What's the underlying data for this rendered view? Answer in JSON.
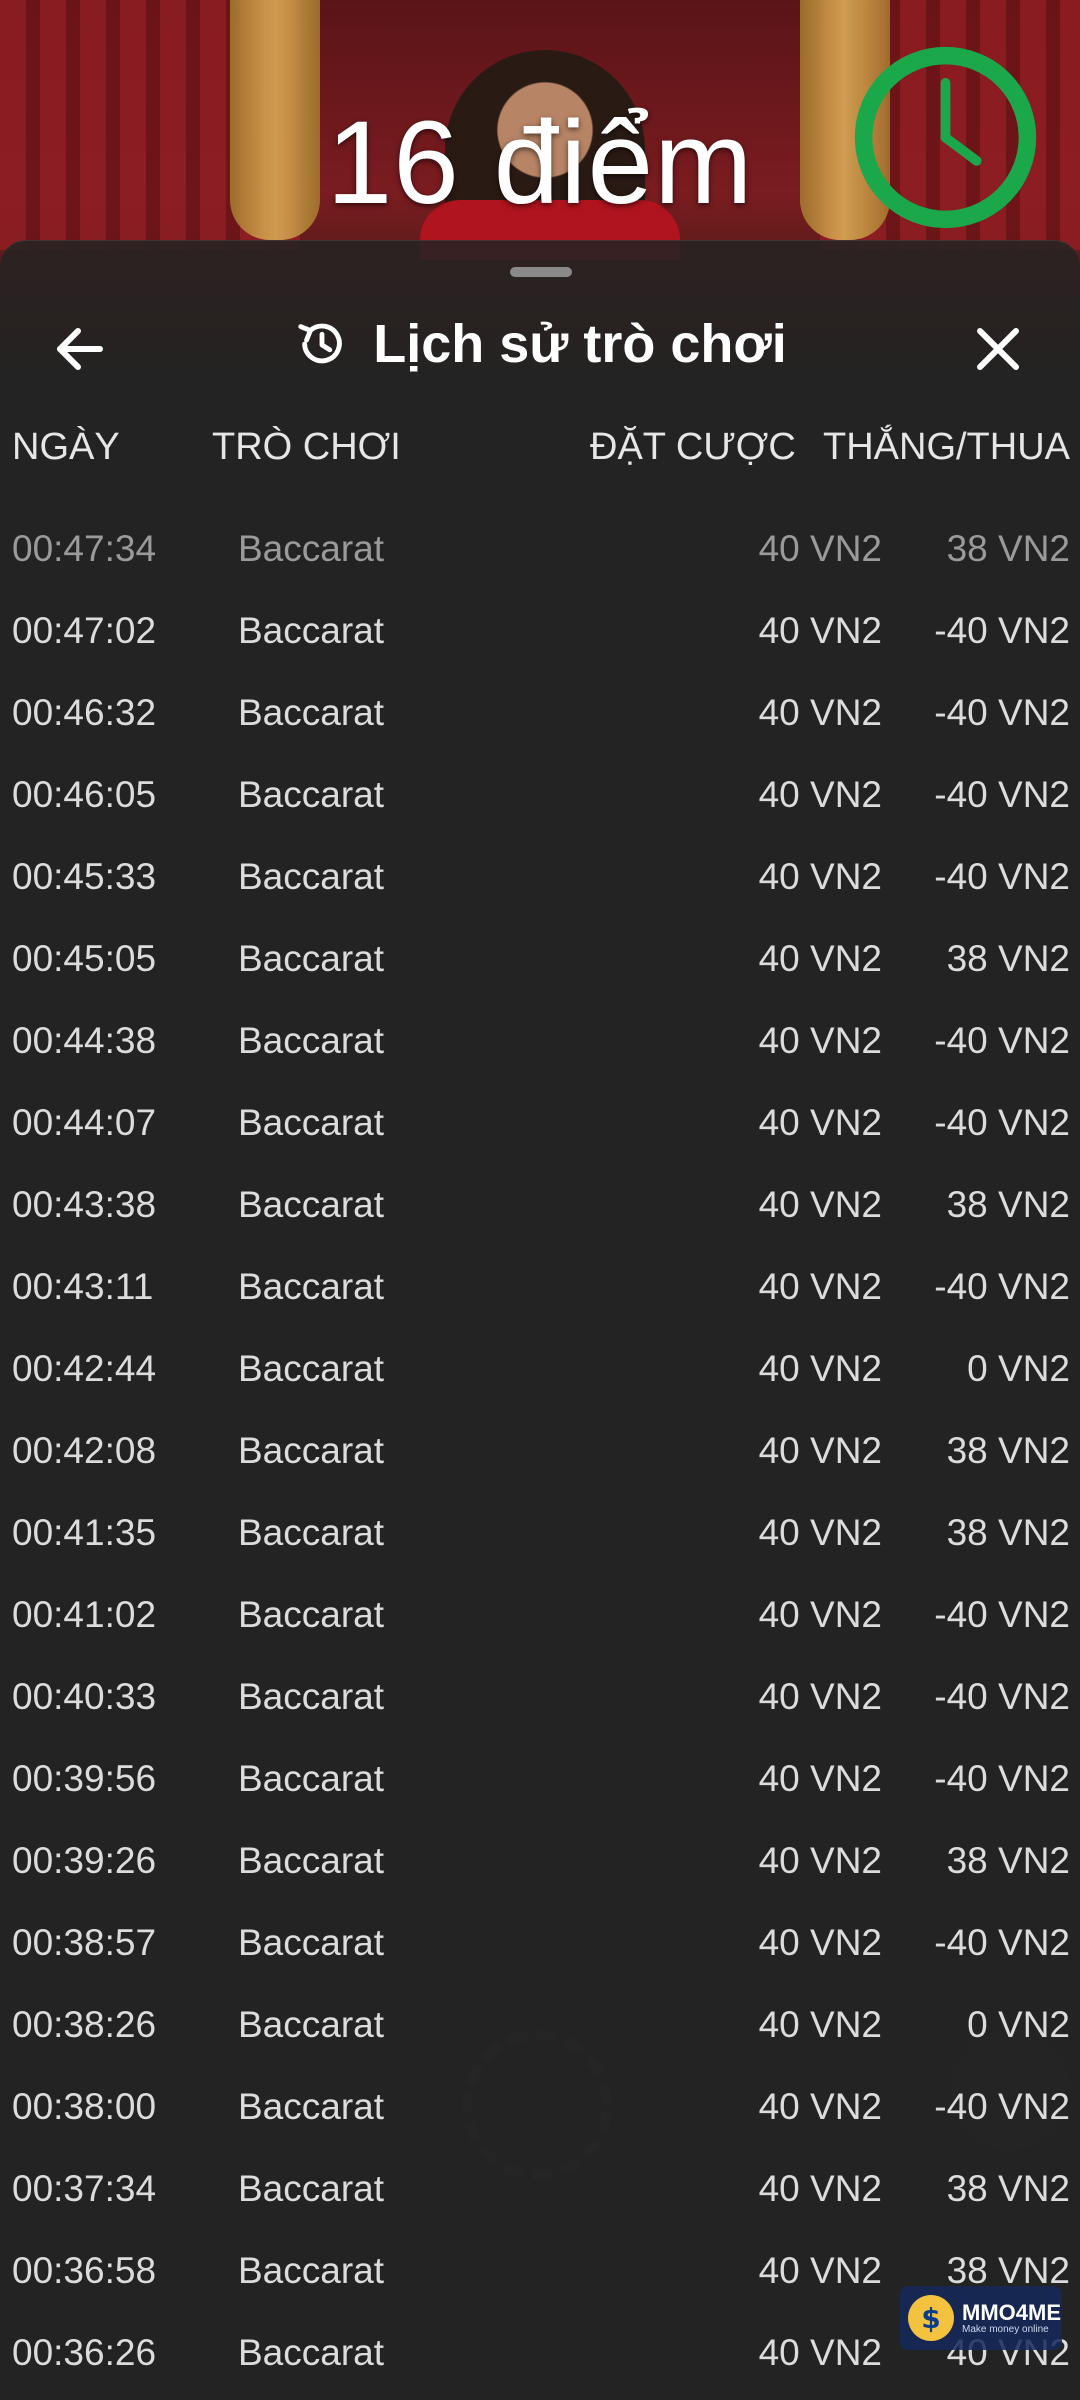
{
  "background": {
    "score_text": "16 điểm"
  },
  "sheet": {
    "title": "Lịch sử trò chơi",
    "columns": {
      "date": "NGÀY",
      "game": "TRÒ CHƠI",
      "bet": "ĐẶT CƯỢC",
      "result": "THẮNG/THUA"
    },
    "rows": [
      {
        "time": "00:47:34",
        "game": "Baccarat",
        "bet": "40 VN2",
        "result": "38 VN2"
      },
      {
        "time": "00:47:02",
        "game": "Baccarat",
        "bet": "40 VN2",
        "result": "-40 VN2"
      },
      {
        "time": "00:46:32",
        "game": "Baccarat",
        "bet": "40 VN2",
        "result": "-40 VN2"
      },
      {
        "time": "00:46:05",
        "game": "Baccarat",
        "bet": "40 VN2",
        "result": "-40 VN2"
      },
      {
        "time": "00:45:33",
        "game": "Baccarat",
        "bet": "40 VN2",
        "result": "-40 VN2"
      },
      {
        "time": "00:45:05",
        "game": "Baccarat",
        "bet": "40 VN2",
        "result": "38 VN2"
      },
      {
        "time": "00:44:38",
        "game": "Baccarat",
        "bet": "40 VN2",
        "result": "-40 VN2"
      },
      {
        "time": "00:44:07",
        "game": "Baccarat",
        "bet": "40 VN2",
        "result": "-40 VN2"
      },
      {
        "time": "00:43:38",
        "game": "Baccarat",
        "bet": "40 VN2",
        "result": "38 VN2"
      },
      {
        "time": "00:43:11",
        "game": "Baccarat",
        "bet": "40 VN2",
        "result": "-40 VN2"
      },
      {
        "time": "00:42:44",
        "game": "Baccarat",
        "bet": "40 VN2",
        "result": "0 VN2"
      },
      {
        "time": "00:42:08",
        "game": "Baccarat",
        "bet": "40 VN2",
        "result": "38 VN2"
      },
      {
        "time": "00:41:35",
        "game": "Baccarat",
        "bet": "40 VN2",
        "result": "38 VN2"
      },
      {
        "time": "00:41:02",
        "game": "Baccarat",
        "bet": "40 VN2",
        "result": "-40 VN2"
      },
      {
        "time": "00:40:33",
        "game": "Baccarat",
        "bet": "40 VN2",
        "result": "-40 VN2"
      },
      {
        "time": "00:39:56",
        "game": "Baccarat",
        "bet": "40 VN2",
        "result": "-40 VN2"
      },
      {
        "time": "00:39:26",
        "game": "Baccarat",
        "bet": "40 VN2",
        "result": "38 VN2"
      },
      {
        "time": "00:38:57",
        "game": "Baccarat",
        "bet": "40 VN2",
        "result": "-40 VN2"
      },
      {
        "time": "00:38:26",
        "game": "Baccarat",
        "bet": "40 VN2",
        "result": "0 VN2"
      },
      {
        "time": "00:38:00",
        "game": "Baccarat",
        "bet": "40 VN2",
        "result": "-40 VN2"
      },
      {
        "time": "00:37:34",
        "game": "Baccarat",
        "bet": "40 VN2",
        "result": "38 VN2"
      },
      {
        "time": "00:36:58",
        "game": "Baccarat",
        "bet": "40 VN2",
        "result": "38 VN2"
      },
      {
        "time": "00:36:26",
        "game": "Baccarat",
        "bet": "40 VN2",
        "result": "40 VN2"
      }
    ]
  },
  "icons": {
    "back": "arrow-left-icon",
    "history": "history-clock-icon",
    "close": "close-icon",
    "timer": "timer-clock-icon"
  },
  "colors": {
    "timer_green": "#1aa84a",
    "sheet_bg": "#242424",
    "text_primary": "#ffffff"
  },
  "watermark": {
    "brand": "MMO4ME",
    "tagline": "Make money online",
    "coin_symbol": "$"
  }
}
